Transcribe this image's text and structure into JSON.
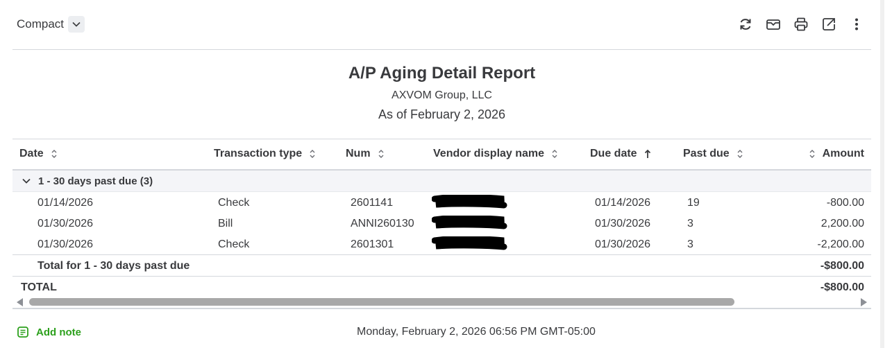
{
  "toolbar": {
    "view_label": "Compact",
    "icons": [
      "refresh-icon",
      "email-icon",
      "print-icon",
      "export-icon",
      "more-options-icon"
    ]
  },
  "report": {
    "title": "A/P Aging Detail Report",
    "company": "AXVOM Group, LLC",
    "as_of": "As of February 2, 2026"
  },
  "columns": {
    "date": "Date",
    "transaction_type": "Transaction type",
    "num": "Num",
    "vendor": "Vendor display name",
    "due_date": "Due date",
    "past_due": "Past due",
    "amount": "Amount"
  },
  "group": {
    "label": "1 - 30 days past due",
    "count": "(3)",
    "total_label": "Total for 1 - 30 days past due",
    "total_amount": "-$800.00"
  },
  "rows": [
    {
      "date": "01/14/2026",
      "type": "Check",
      "num": "2601141",
      "due_date": "01/14/2026",
      "past_due": "19",
      "amount": "-800.00"
    },
    {
      "date": "01/30/2026",
      "type": "Bill",
      "num": "ANNI260130",
      "due_date": "01/30/2026",
      "past_due": "3",
      "amount": "2,200.00"
    },
    {
      "date": "01/30/2026",
      "type": "Check",
      "num": "2601301",
      "due_date": "01/30/2026",
      "past_due": "3",
      "amount": "-2,200.00"
    }
  ],
  "total": {
    "label": "TOTAL",
    "amount": "-$800.00"
  },
  "footer": {
    "add_note": "Add note",
    "timestamp": "Monday, February 2, 2026 06:56 PM GMT-05:00"
  },
  "colors": {
    "accent_green": "#2ca01c",
    "text": "#393a3d",
    "group_bg": "#f4f5f8"
  }
}
